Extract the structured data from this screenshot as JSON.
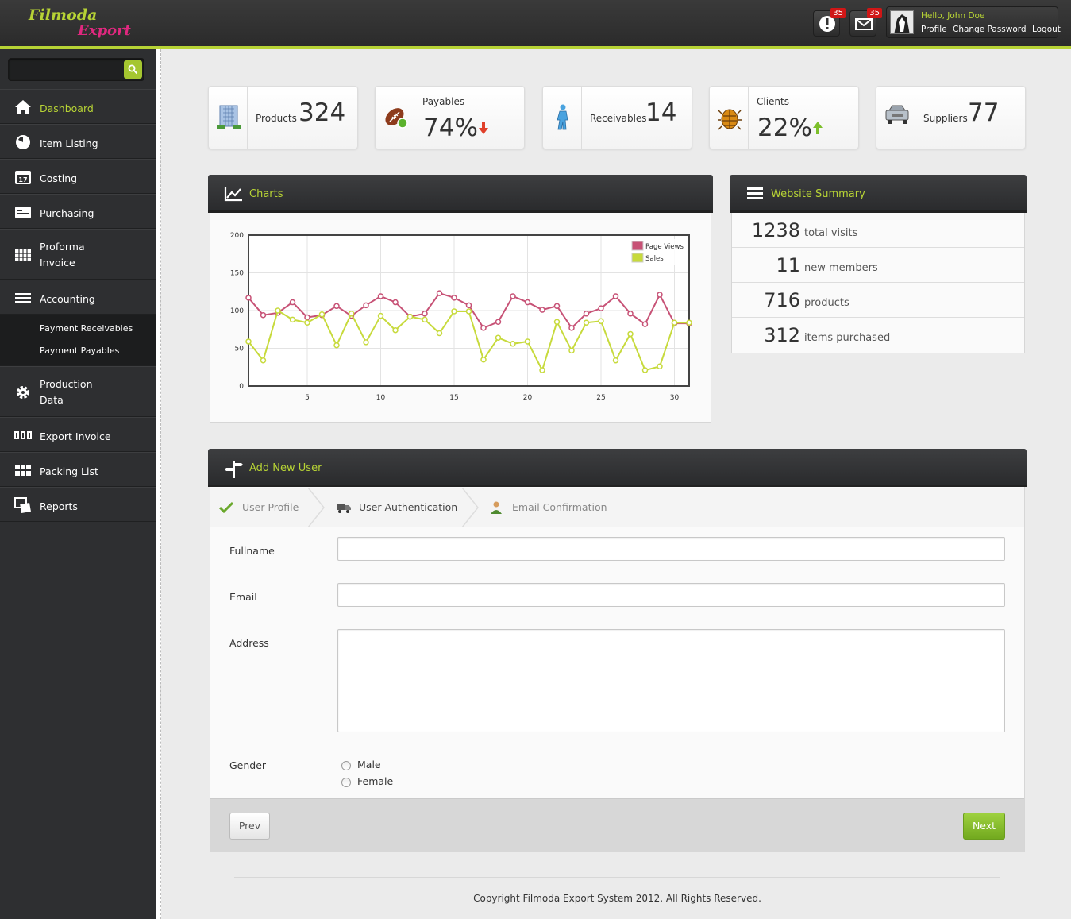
{
  "brand": {
    "line1": "Filmoda",
    "line2": "Export"
  },
  "header": {
    "alerts_count": "35",
    "messages_count": "35",
    "greeting": "Hello, John Doe",
    "links": [
      "Profile",
      "Change Password",
      "Logout"
    ]
  },
  "sidebar": {
    "search_placeholder": "",
    "items": [
      {
        "label": "Dashboard",
        "icon": "home-icon",
        "active": true
      },
      {
        "label": "Item Listing",
        "icon": "clock-icon"
      },
      {
        "label": "Costing",
        "icon": "calendar-icon"
      },
      {
        "label": "Purchasing",
        "icon": "cart-icon"
      },
      {
        "label": "Proforma Invoice",
        "line1": "Proforma",
        "line2": "Invoice",
        "icon": "grid-icon"
      },
      {
        "label": "Accounting",
        "icon": "list-icon"
      },
      {
        "label": "Production Data",
        "line1": "Production",
        "line2": "Data",
        "icon": "gear-icon"
      },
      {
        "label": "Export Invoice",
        "icon": "invoice-icon"
      },
      {
        "label": "Packing List",
        "icon": "boxes-icon"
      },
      {
        "label": "Reports",
        "icon": "reports-icon"
      }
    ],
    "accounting_sub": [
      "Payment Receivables",
      "Payment Payables"
    ]
  },
  "stats": [
    {
      "label": "Products",
      "value": "324",
      "icon": "building-icon"
    },
    {
      "label": "Payables",
      "value": "74%",
      "icon": "football-icon",
      "trend": "down"
    },
    {
      "label": "Receivables",
      "value": "14",
      "icon": "person-icon"
    },
    {
      "label": "Clients",
      "value": "22%",
      "icon": "bug-icon",
      "trend": "up"
    },
    {
      "label": "Suppliers",
      "value": "77",
      "icon": "car-icon"
    }
  ],
  "charts_panel": {
    "title": "Charts"
  },
  "chart_data": {
    "type": "line",
    "x": [
      1,
      2,
      3,
      4,
      5,
      6,
      7,
      8,
      9,
      10,
      11,
      12,
      13,
      14,
      15,
      16,
      17,
      18,
      19,
      20,
      21,
      22,
      23,
      24,
      25,
      26,
      27,
      28,
      29,
      30,
      31
    ],
    "xticks": [
      "5",
      "10",
      "15",
      "20",
      "25",
      "30"
    ],
    "yticks": [
      "0",
      "50",
      "100",
      "150",
      "200"
    ],
    "ylim": [
      0,
      200
    ],
    "xlim": [
      1,
      31
    ],
    "grid": true,
    "legend": "top-right",
    "series": [
      {
        "name": "Page Views",
        "color": "#c75276",
        "values": [
          117,
          94,
          97,
          111,
          91,
          94,
          106,
          93,
          107,
          119,
          111,
          92,
          96,
          123,
          117,
          107,
          77,
          85,
          119,
          111,
          101,
          106,
          77,
          96,
          103,
          119,
          96,
          82,
          121,
          83,
          83
        ]
      },
      {
        "name": "Sales",
        "color": "#c7da3c",
        "values": [
          59,
          34,
          100,
          88,
          84,
          95,
          54,
          96,
          58,
          93,
          74,
          92,
          88,
          70,
          99,
          99,
          35,
          64,
          56,
          59,
          21,
          85,
          47,
          84,
          86,
          34,
          69,
          21,
          26,
          84,
          84
        ]
      }
    ]
  },
  "summary": {
    "title": "Website Summary",
    "rows": [
      {
        "value": "1238",
        "label": "total visits"
      },
      {
        "value": "11",
        "label": "new members"
      },
      {
        "value": "716",
        "label": "products"
      },
      {
        "value": "312",
        "label": "items purchased"
      }
    ]
  },
  "form": {
    "title": "Add New User",
    "tabs": [
      "User Profile",
      "User Authentication",
      "Email Confirmation"
    ],
    "fields": {
      "fullname": "Fullname",
      "email": "Email",
      "address": "Address",
      "gender": "Gender"
    },
    "gender_options": [
      "Male",
      "Female"
    ],
    "prev": "Prev",
    "next": "Next"
  },
  "footer": {
    "copyright": "Copyright Filmoda Export System 2012. All Rights Reserved."
  }
}
